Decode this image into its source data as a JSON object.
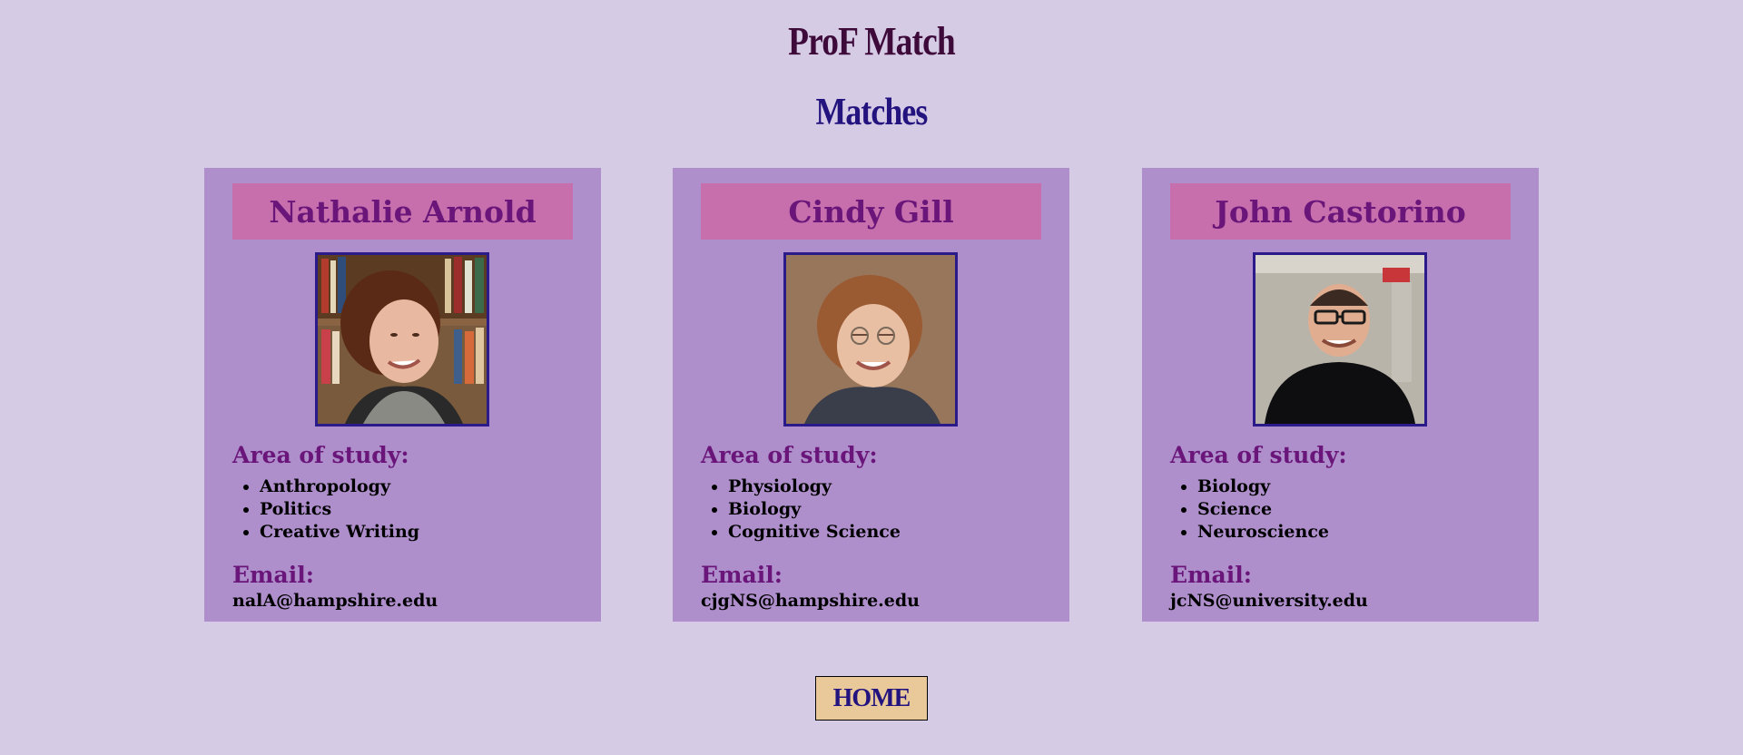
{
  "header": {
    "title": "ProF Match",
    "subtitle": "Matches"
  },
  "matches": [
    {
      "name": "Nathalie Arnold",
      "area_label": "Area of study:",
      "subjects": [
        "Anthropology",
        "Politics",
        "Creative Writing"
      ],
      "email_label": "Email:",
      "email": "nalA@hampshire.edu"
    },
    {
      "name": "Cindy Gill",
      "area_label": "Area of study:",
      "subjects": [
        "Physiology",
        "Biology",
        "Cognitive Science"
      ],
      "email_label": "Email:",
      "email": "cjgNS@hampshire.edu"
    },
    {
      "name": "John Castorino",
      "area_label": "Area of study:",
      "subjects": [
        "Biology",
        "Science",
        "Neuroscience"
      ],
      "email_label": "Email:",
      "email": "jcNS@university.edu"
    }
  ],
  "footer": {
    "home_label": "HOME"
  },
  "colors": {
    "background": "#d5cbe5",
    "card": "#ae8ecb",
    "banner": "#c66fac",
    "heading_purple": "#6a1579",
    "title_dark": "#3d0a3a",
    "subtitle_blue": "#23137e",
    "button": "#e9c99a"
  }
}
